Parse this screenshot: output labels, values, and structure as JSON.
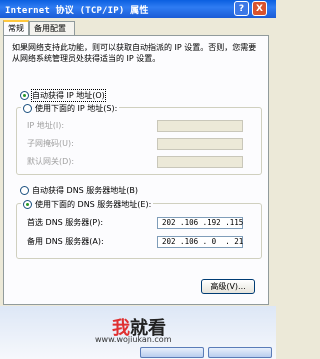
{
  "window": {
    "title": "Internet 协议 (TCP/IP) 属性",
    "help_label": "?",
    "close_label": "X"
  },
  "tabs": [
    {
      "label": "常规",
      "active": true
    },
    {
      "label": "备用配置",
      "active": false
    }
  ],
  "description": "如果网络支持此功能，则可以获取自动指派的 IP 设置。否则，您需要从网络系统管理员处获得适当的 IP 设置。",
  "ip": {
    "auto_label": "自动获得 IP 地址(O)",
    "auto_checked": true,
    "manual_label": "使用下面的 IP 地址(S):",
    "manual_checked": false,
    "fields": [
      {
        "label": "IP 地址(I):",
        "value": ""
      },
      {
        "label": "子网掩码(U):",
        "value": ""
      },
      {
        "label": "默认网关(D):",
        "value": ""
      }
    ]
  },
  "dns": {
    "auto_label": "自动获得 DNS 服务器地址(B)",
    "auto_checked": false,
    "manual_label": "使用下面的 DNS 服务器地址(E):",
    "manual_checked": true,
    "fields": [
      {
        "label": "首选 DNS 服务器(P):",
        "value": "202 .106 .192 .115"
      },
      {
        "label": "备用 DNS 服务器(A):",
        "value": "202 .106 . 0  . 21"
      }
    ]
  },
  "advanced_label": "高级(V)...",
  "watermark": {
    "logo_red": "我",
    "logo_rest": "就看",
    "url": "www.wojiukan.com"
  },
  "colors": {
    "title_bar": "#1A5BD6",
    "radio_dot": "#2A9A2A",
    "logo_accent": "#E03030"
  }
}
